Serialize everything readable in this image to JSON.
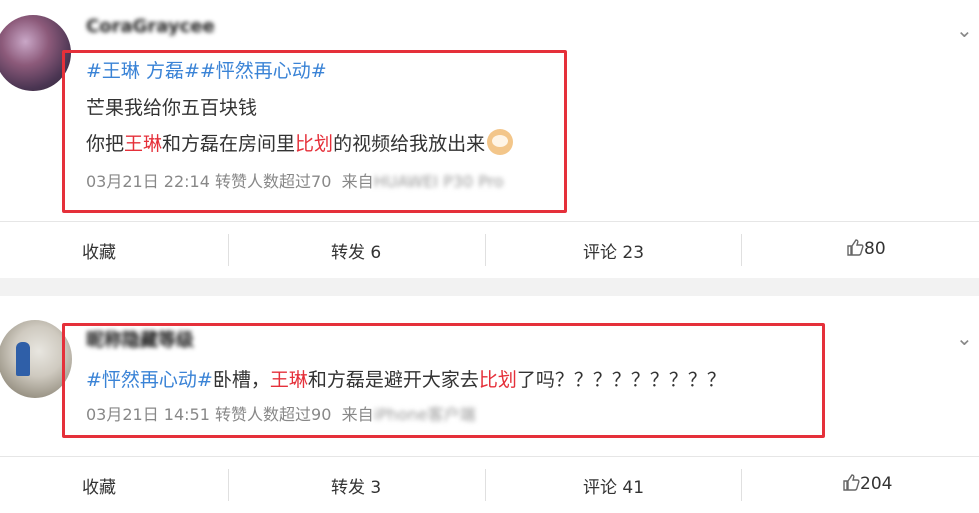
{
  "posts": [
    {
      "username": "CoraGraycee",
      "line1_tags": [
        "#王琳 方磊#",
        "#怦然再心动#"
      ],
      "line2": "芒果我给你五百块钱",
      "line3": {
        "pre": "你把",
        "hl1": "王琳",
        "mid": "和方磊在房间里",
        "hl2": "比划",
        "post": "的视频给我放出来"
      },
      "date": "03月21日 22:14",
      "reposts_info": "转赞人数超过70",
      "source_label": "来自",
      "source": "HUAWEI P30 Pro",
      "actions": {
        "fav": "收藏",
        "repost": "转发 6",
        "comment": "评论 23",
        "like": "80"
      }
    },
    {
      "username": "昵称隐藏等级",
      "line1": {
        "tag": "#怦然再心动#",
        "t1": "卧槽，",
        "hl1": "王琳",
        "t2": "和方磊是避开大家去",
        "hl2": "比划",
        "t3": "了吗？？？？？？？？？"
      },
      "date": "03月21日 14:51",
      "reposts_info": "转赞人数超过90",
      "source_label": "来自",
      "source": "iPhone客户端",
      "actions": {
        "fav": "收藏",
        "repost": "转发 3",
        "comment": "评论 41",
        "like": "204"
      }
    }
  ],
  "icons": {
    "chevron": "chevron-down-icon",
    "like": "thumbs-up-icon",
    "emoji": "cat-emoji-icon"
  },
  "colors": {
    "tag": "#3a83d6",
    "highlight": "#e5303a",
    "box": "#e5303a"
  }
}
